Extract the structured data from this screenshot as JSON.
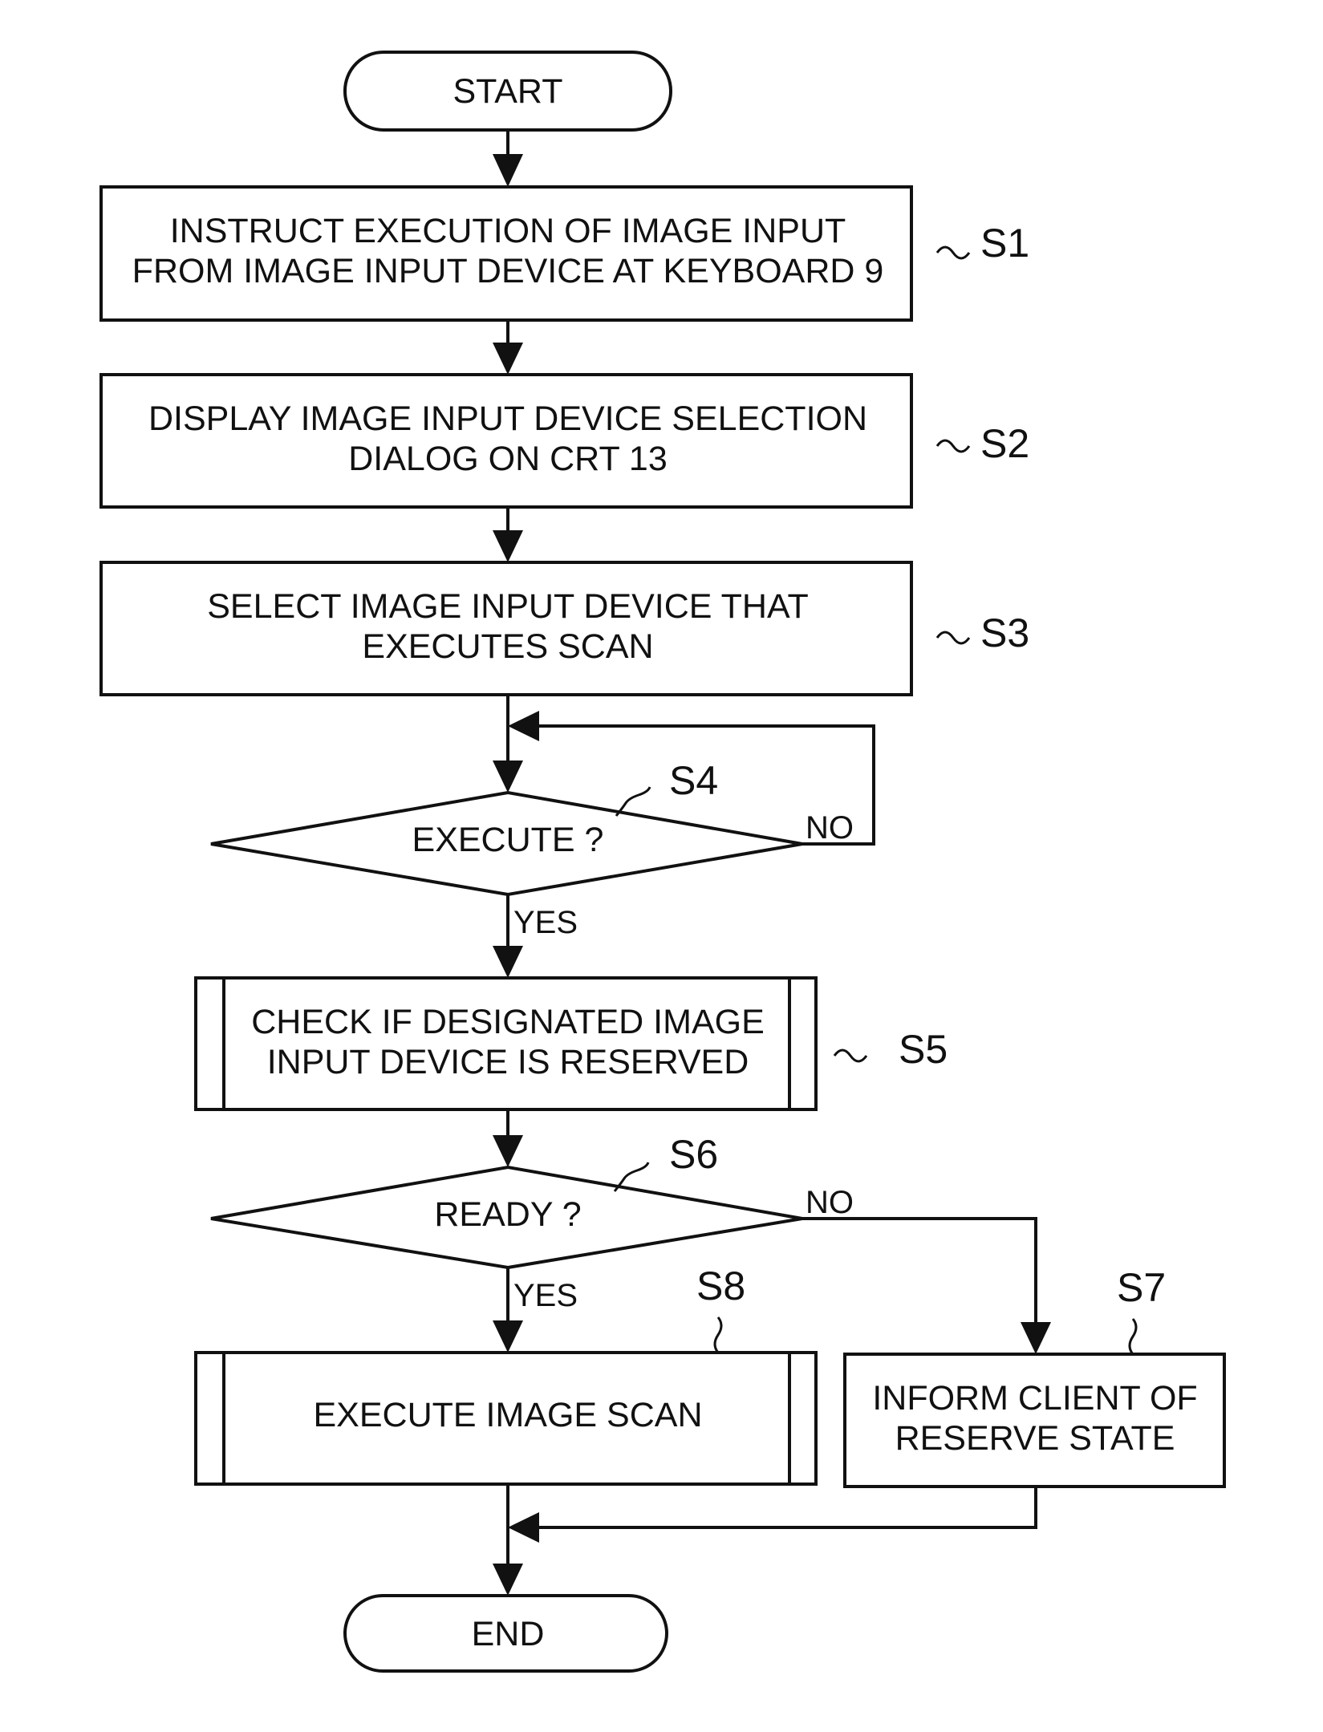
{
  "diagram": {
    "type": "flowchart",
    "nodes": {
      "start": {
        "label": "START",
        "shape": "terminator"
      },
      "s1": {
        "step": "S1",
        "shape": "process",
        "lines": [
          "INSTRUCT EXECUTION OF IMAGE INPUT",
          "FROM IMAGE INPUT DEVICE AT KEYBOARD 9"
        ]
      },
      "s2": {
        "step": "S2",
        "shape": "process",
        "lines": [
          "DISPLAY IMAGE INPUT DEVICE SELECTION",
          "DIALOG ON CRT 13"
        ]
      },
      "s3": {
        "step": "S3",
        "shape": "process",
        "lines": [
          "SELECT IMAGE INPUT DEVICE THAT",
          "EXECUTES SCAN"
        ]
      },
      "s4": {
        "step": "S4",
        "shape": "decision",
        "label": "EXECUTE ?",
        "yes_label": "YES",
        "no_label": "NO"
      },
      "s5": {
        "step": "S5",
        "shape": "predefined-process",
        "lines": [
          "CHECK IF DESIGNATED IMAGE",
          "INPUT DEVICE IS RESERVED"
        ]
      },
      "s6": {
        "step": "S6",
        "shape": "decision",
        "label": "READY ?",
        "yes_label": "YES",
        "no_label": "NO"
      },
      "s7": {
        "step": "S7",
        "shape": "process",
        "lines": [
          "INFORM CLIENT OF",
          "RESERVE STATE"
        ]
      },
      "s8": {
        "step": "S8",
        "shape": "predefined-process",
        "lines": [
          "EXECUTE IMAGE SCAN"
        ]
      },
      "end": {
        "label": "END",
        "shape": "terminator"
      }
    },
    "edges": [
      {
        "from": "START",
        "to": "S1"
      },
      {
        "from": "S1",
        "to": "S2"
      },
      {
        "from": "S2",
        "to": "S3"
      },
      {
        "from": "S3",
        "to": "S4"
      },
      {
        "from": "S4",
        "to": "S4",
        "label": "NO"
      },
      {
        "from": "S4",
        "to": "S5",
        "label": "YES"
      },
      {
        "from": "S5",
        "to": "S6"
      },
      {
        "from": "S6",
        "to": "S8",
        "label": "YES"
      },
      {
        "from": "S6",
        "to": "S7",
        "label": "NO"
      },
      {
        "from": "S8",
        "to": "END"
      },
      {
        "from": "S7",
        "to": "END"
      }
    ]
  }
}
